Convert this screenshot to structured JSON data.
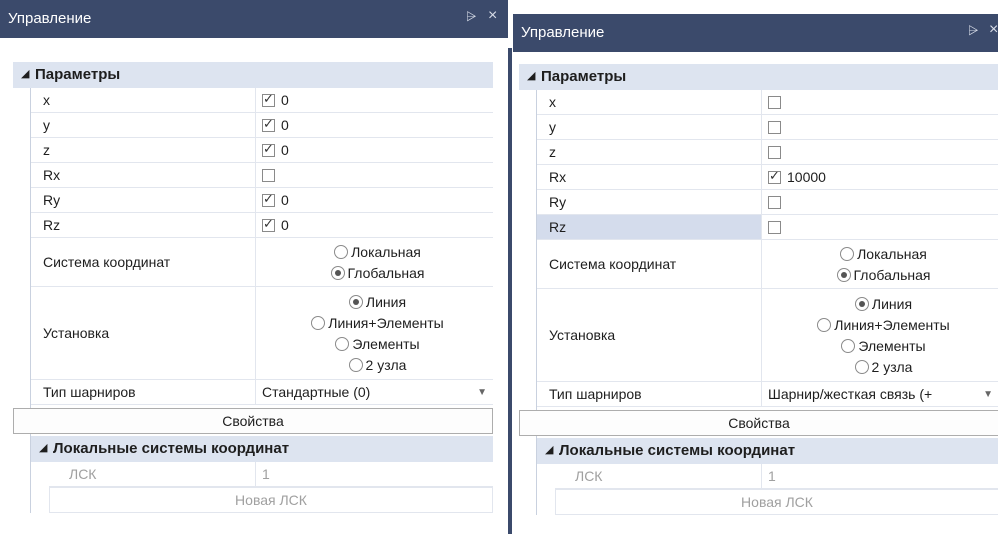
{
  "colors": {
    "titlebar": "#3b4a6b",
    "section_header": "#dde4f0",
    "selected_row": "#d4dcec"
  },
  "icons": {
    "pin": "pin-icon",
    "close": "close-icon",
    "collapse": "triangle-down-icon"
  },
  "left": {
    "title": "Управление",
    "pin": "ᵖ",
    "close": "×",
    "section": "Параметры",
    "rows": [
      {
        "name": "x",
        "checked": true,
        "value": "0"
      },
      {
        "name": "y",
        "checked": true,
        "value": "0"
      },
      {
        "name": "z",
        "checked": true,
        "value": "0"
      },
      {
        "name": "Rx",
        "checked": false,
        "value": ""
      },
      {
        "name": "Ry",
        "checked": true,
        "value": "0"
      },
      {
        "name": "Rz",
        "checked": true,
        "value": "0"
      }
    ],
    "coord_label": "Система координат",
    "coord_opt1": "Локальная",
    "coord_opt2": "Глобальная",
    "install_label": "Установка",
    "install_opt1": "Линия",
    "install_opt2": "Линия+Элементы",
    "install_opt3": "Элементы",
    "install_opt4": "2 узла",
    "hinge_label": "Тип шарниров",
    "hinge_value": "Стандартные (0)",
    "properties_button": "Свойства",
    "lsk_section": "Локальные системы координат",
    "lsk_label": "ЛСК",
    "lsk_value": "1",
    "new_lsk": "Новая ЛСК"
  },
  "right": {
    "title": "Управление",
    "pin": "ᵖ",
    "close": "×",
    "section": "Параметры",
    "rows": [
      {
        "name": "x",
        "checked": false,
        "value": ""
      },
      {
        "name": "y",
        "checked": false,
        "value": ""
      },
      {
        "name": "z",
        "checked": false,
        "value": ""
      },
      {
        "name": "Rx",
        "checked": true,
        "value": "10000"
      },
      {
        "name": "Ry",
        "checked": false,
        "value": ""
      },
      {
        "name": "Rz",
        "checked": false,
        "value": ""
      }
    ],
    "coord_label": "Система координат",
    "coord_opt1": "Локальная",
    "coord_opt2": "Глобальная",
    "install_label": "Установка",
    "install_opt1": "Линия",
    "install_opt2": "Линия+Элементы",
    "install_opt3": "Элементы",
    "install_opt4": "2 узла",
    "hinge_label": "Тип шарниров",
    "hinge_value": "Шарнир/жесткая связь (+",
    "properties_button": "Свойства",
    "lsk_section": "Локальные системы координат",
    "lsk_label": "ЛСК",
    "lsk_value": "1",
    "new_lsk": "Новая ЛСК"
  }
}
